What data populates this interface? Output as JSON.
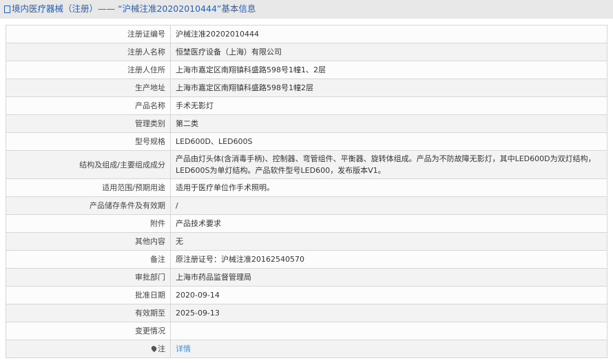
{
  "header": {
    "title": "境内医疗器械（注册）—— “沪械注准20202010444”基本信息"
  },
  "rows": [
    {
      "label": "注册证编号",
      "value": "沪械注准20202010444"
    },
    {
      "label": "注册人名称",
      "value": "恒埜医疗设备（上海）有限公司"
    },
    {
      "label": "注册人住所",
      "value": "上海市嘉定区南翔镇科盛路598号1幢1、2层"
    },
    {
      "label": "生产地址",
      "value": "上海市嘉定区南翔镇科盛路598号1幢2层"
    },
    {
      "label": "产品名称",
      "value": "手术无影灯"
    },
    {
      "label": "管理类别",
      "value": "第二类"
    },
    {
      "label": "型号规格",
      "value": "LED600D、LED600S"
    },
    {
      "label": "结构及组成/主要组成成分",
      "value": "产品由灯头体(含消毒手柄)、控制器、弯管组件、平衡器、旋转体组成。产品为不防故障无影灯，其中LED600D为双灯结构，LED600S为单灯结构。产品软件型号LED600，发布版本V1。"
    },
    {
      "label": "适用范围/预期用途",
      "value": "适用于医疗单位作手术照明。"
    },
    {
      "label": "产品储存条件及有效期",
      "value": "/"
    },
    {
      "label": "附件",
      "value": "产品技术要求"
    },
    {
      "label": "其他内容",
      "value": "无"
    },
    {
      "label": "备注",
      "value": "原注册证号：沪械注准20162540570"
    },
    {
      "label": "审批部门",
      "value": "上海市药品监督管理局"
    },
    {
      "label": "批准日期",
      "value": "2020-09-14"
    },
    {
      "label": "有效期至",
      "value": "2025-09-13"
    },
    {
      "label": "变更情况",
      "value": ""
    }
  ],
  "note": {
    "label": "注",
    "link": "详情"
  }
}
